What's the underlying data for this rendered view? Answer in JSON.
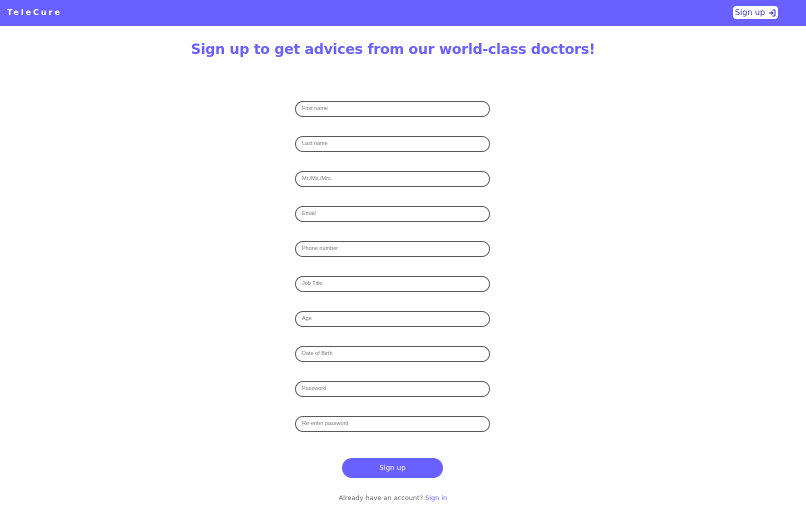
{
  "navbar": {
    "brand": "TeleCure",
    "signup_label": "Sign up",
    "signup_icon": "sign-in-arrow-icon"
  },
  "main": {
    "heading": "Sign up to get advices from our world-class doctors!",
    "fields": [
      {
        "placeholder": "First name",
        "value": ""
      },
      {
        "placeholder": "Last name",
        "value": ""
      },
      {
        "placeholder": "Mr./Ms./Mrs.",
        "value": ""
      },
      {
        "placeholder": "Email",
        "value": ""
      },
      {
        "placeholder": "Phone number",
        "value": ""
      },
      {
        "placeholder": "Job Title",
        "value": ""
      },
      {
        "placeholder": "Age",
        "value": ""
      },
      {
        "placeholder": "Date of Birth",
        "value": ""
      },
      {
        "placeholder": "Password",
        "value": ""
      },
      {
        "placeholder": "Re-enter password",
        "value": ""
      }
    ],
    "submit_label": "Sign up",
    "footer_text": "Already have an account?",
    "footer_link": "Sign in"
  },
  "colors": {
    "brand": "#6a60ff",
    "field_border": "#5a5a5a"
  }
}
